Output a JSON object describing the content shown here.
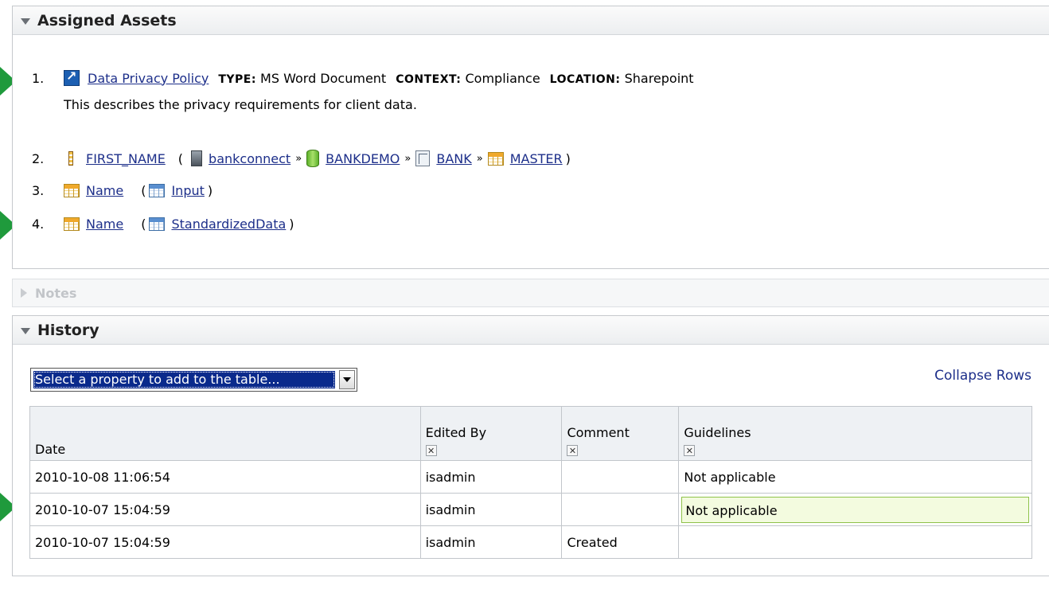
{
  "assigned_assets": {
    "title": "Assigned Assets",
    "items": [
      {
        "num": "1.",
        "link": "Data Privacy Policy",
        "type_label": "TYPE:",
        "type_value": "MS Word Document",
        "context_label": "CONTEXT:",
        "context_value": "Compliance",
        "location_label": "LOCATION:",
        "location_value": "Sharepoint",
        "description": "This describes the privacy requirements for client data."
      },
      {
        "num": "2.",
        "name": "FIRST_NAME",
        "path": [
          "bankconnect",
          "BANKDEMO",
          "BANK",
          "MASTER"
        ]
      },
      {
        "num": "3.",
        "name": "Name",
        "parent": "Input"
      },
      {
        "num": "4.",
        "name": "Name",
        "parent": "StandardizedData"
      }
    ]
  },
  "notes": {
    "title": "Notes"
  },
  "history": {
    "title": "History",
    "select_value": "Select a property to add to the table...",
    "collapse_label": "Collapse Rows",
    "columns": [
      "Date",
      "Edited By",
      "Comment",
      "Guidelines"
    ],
    "rows": [
      {
        "date": "2010-10-08  11:06:54",
        "edited_by": "isadmin",
        "comment": "",
        "guidelines": "Not applicable"
      },
      {
        "date": "2010-10-07  15:04:59",
        "edited_by": "isadmin",
        "comment": "",
        "guidelines": "Not applicable"
      },
      {
        "date": "2010-10-07  15:04:59",
        "edited_by": "isadmin",
        "comment": "Created",
        "guidelines": ""
      }
    ]
  },
  "colors": {
    "link": "#1d2f8a",
    "callout": "#1f9a3c",
    "selection": "#0a2a8c",
    "edit_highlight": "#f3fbdf"
  },
  "icons": [
    "external-link-icon",
    "column-icon",
    "server-icon",
    "database-icon",
    "schema-icon",
    "table-icon",
    "data-file-icon",
    "dropdown-arrow-icon",
    "remove-column-icon"
  ],
  "separator": "»",
  "paren_open": "(",
  "paren_close": ")"
}
